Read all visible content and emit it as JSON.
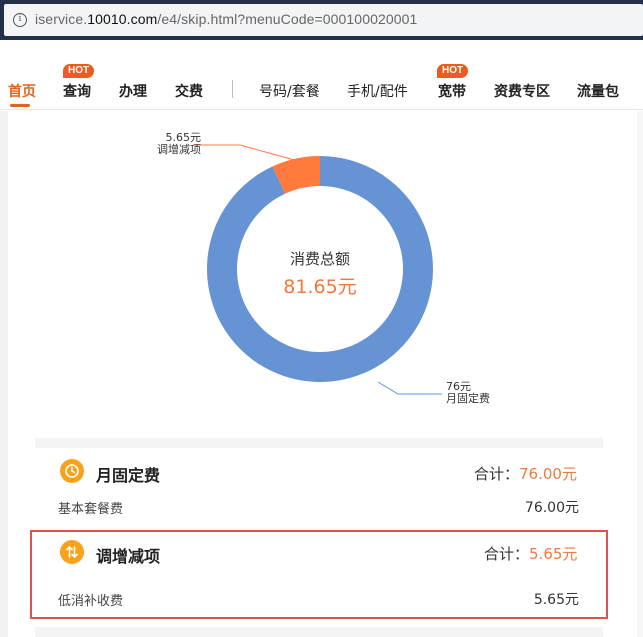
{
  "browser": {
    "url_prefix": "iservice.",
    "url_host": "10010.com",
    "url_path": "/e4/skip.html?menuCode=000100020001"
  },
  "nav": {
    "items": [
      {
        "label": "首页",
        "active": true
      },
      {
        "label": "查询",
        "hot": true
      },
      {
        "label": "办理"
      },
      {
        "label": "交费"
      },
      {
        "label": "号码/套餐"
      },
      {
        "label": "手机/配件"
      },
      {
        "label": "宽带",
        "hot": true
      },
      {
        "label": "资费专区"
      },
      {
        "label": "流量包"
      }
    ],
    "hot_label": "HOT"
  },
  "chart_data": {
    "type": "pie",
    "center_label": "消费总额",
    "center_value": "81.65元",
    "slices": [
      {
        "name": "月固定费",
        "value": 76,
        "label": "76元",
        "color": "#6693d4"
      },
      {
        "name": "调增减项",
        "value": 5.65,
        "label": "5.65元",
        "color": "#ff7a3c"
      }
    ]
  },
  "sections": [
    {
      "title": "月固定费",
      "icon": "clock-icon",
      "total_label": "合计：",
      "total_value": "76.00元",
      "items": [
        {
          "label": "基本套餐费",
          "value": "76.00元"
        }
      ]
    },
    {
      "title": "调增减项",
      "icon": "up-down-arrows-icon",
      "total_label": "合计：",
      "total_value": "5.65元",
      "items": [
        {
          "label": "低消补收费",
          "value": "5.65元"
        }
      ]
    }
  ],
  "colors": {
    "accent": "#e3651d",
    "amount": "#ef7a3f",
    "highlight_border": "#e0524e",
    "icon_bg": "#f7a21b"
  }
}
